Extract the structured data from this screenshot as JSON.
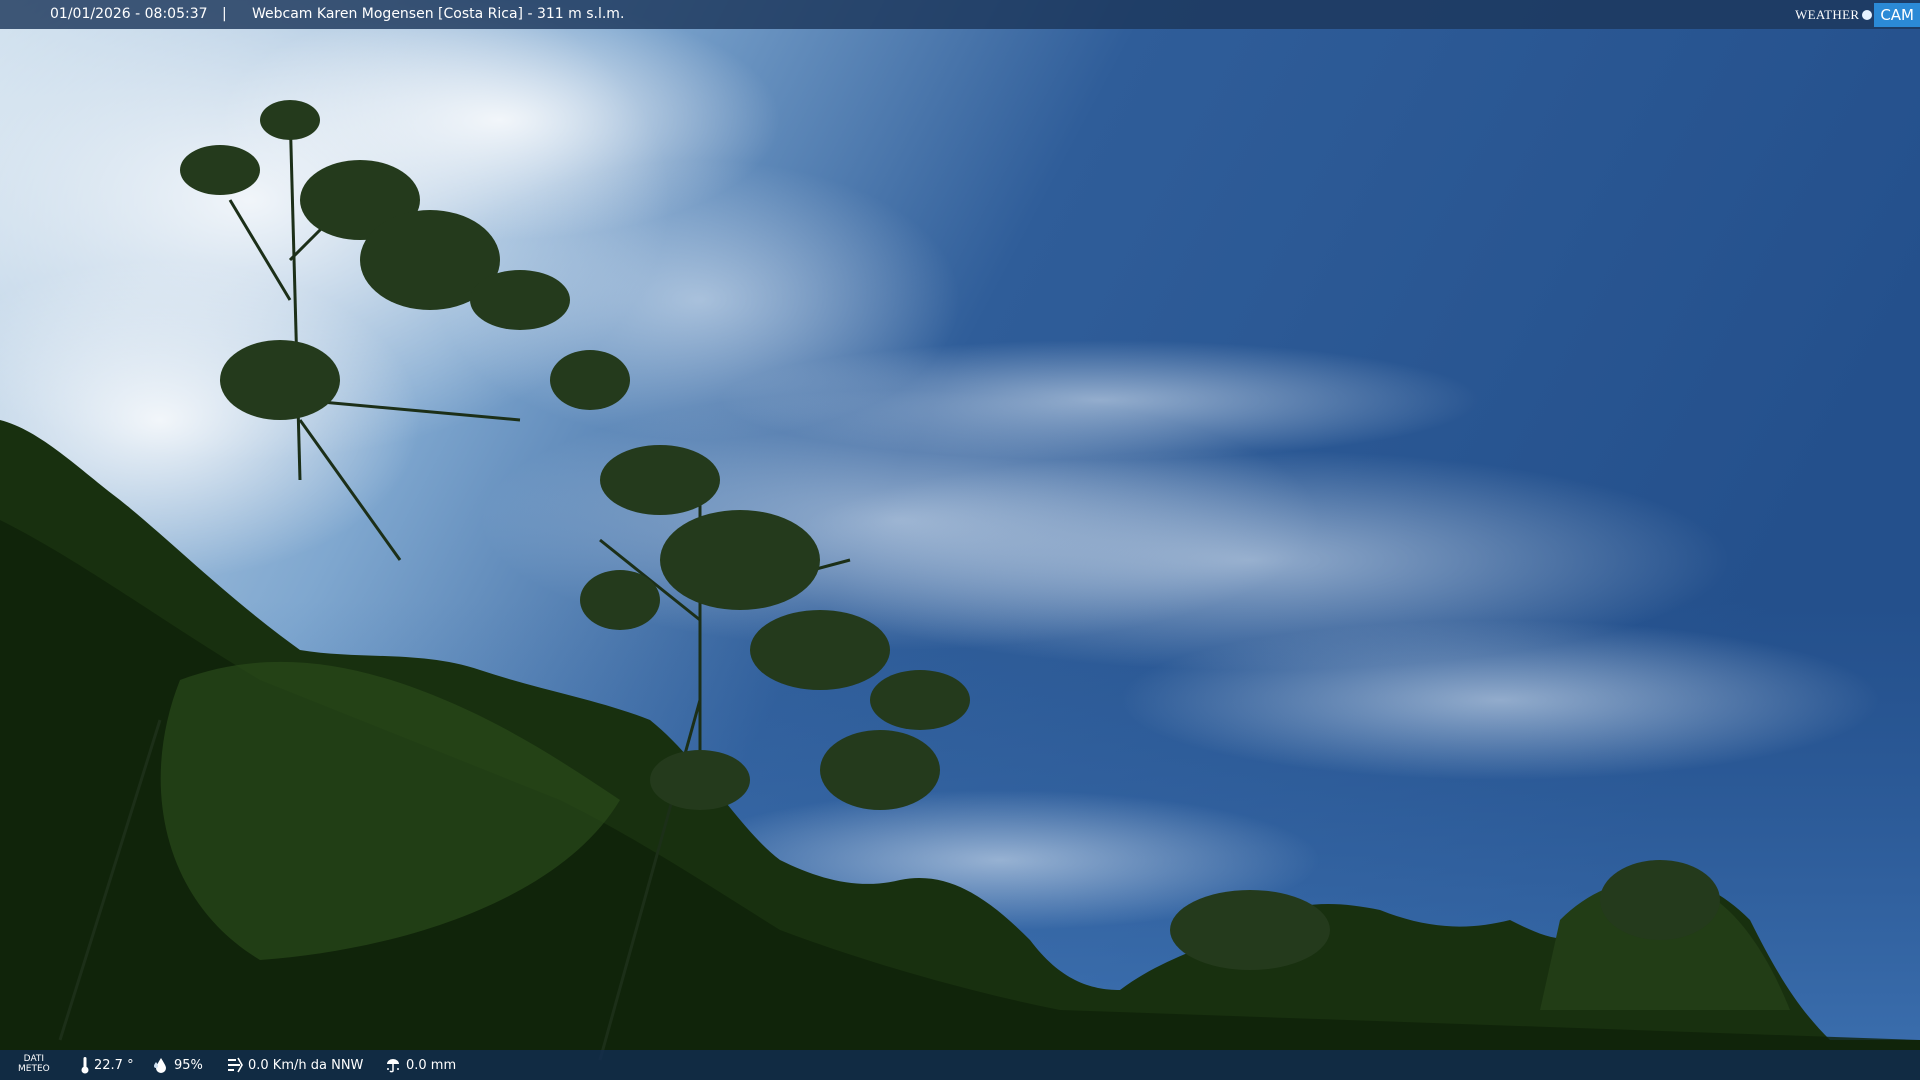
{
  "topbar": {
    "datetime": "01/01/2026 - 08:05:37",
    "separator": "|",
    "title": "Webcam Karen Mogensen [Costa Rica] - 311 m s.l.m."
  },
  "logo": {
    "weather": "WEATHER",
    "cam": "CAM"
  },
  "bottombar": {
    "meteo_label_line1": "DATI",
    "meteo_label_line2": "METEO",
    "temperature": "22.7 °",
    "humidity": "95%",
    "wind": "0.0 Km/h da NNW",
    "rain": "0.0 mm"
  },
  "icons": {
    "temperature": "thermometer-icon",
    "humidity": "drops-icon",
    "wind": "wind-icon",
    "rain": "rain-gauge-icon"
  }
}
